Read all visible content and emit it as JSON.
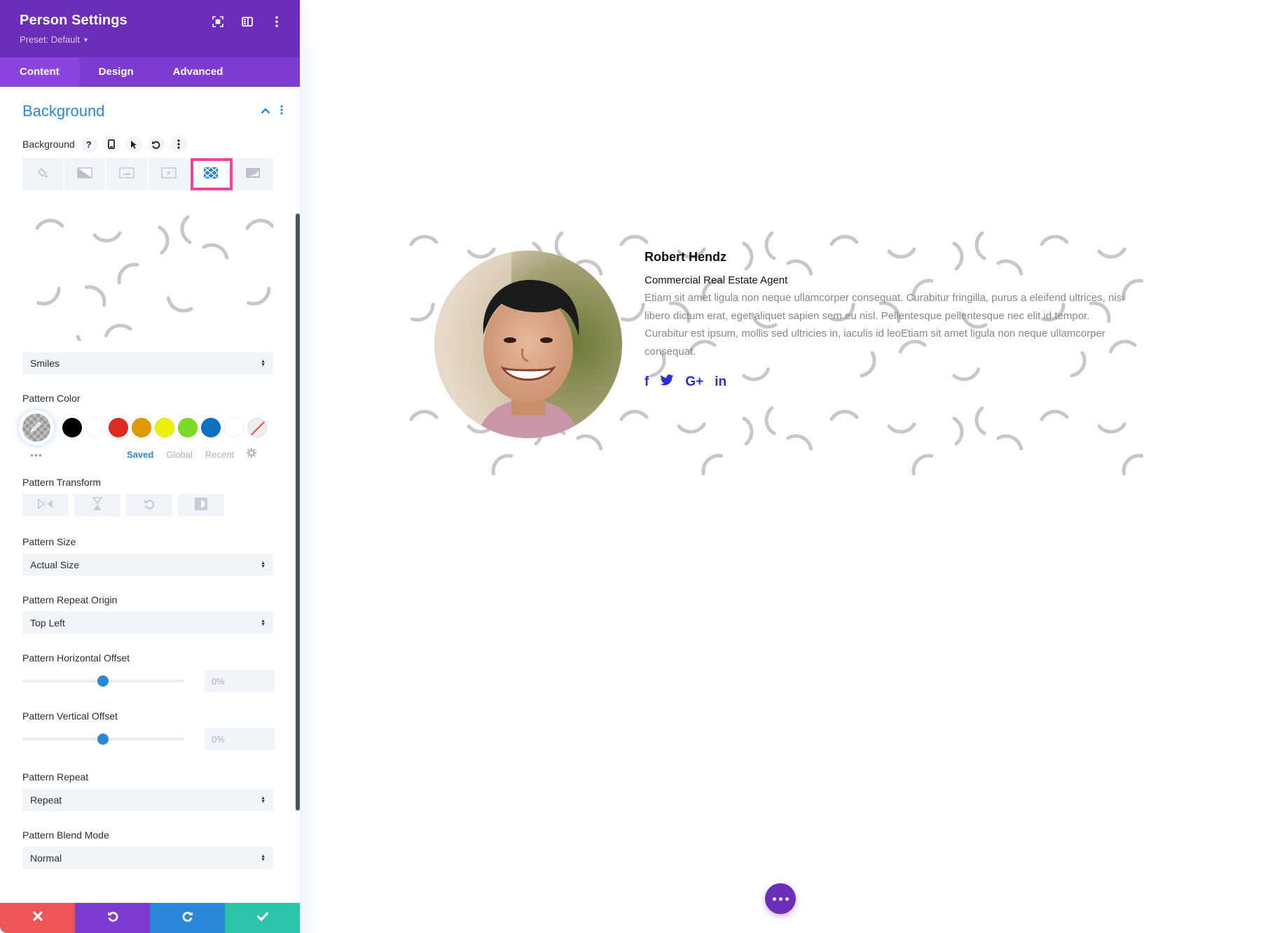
{
  "panel": {
    "title": "Person Settings",
    "preset_label": "Preset: Default",
    "header_icons": [
      "fullscreen-icon",
      "sidebar-toggle-icon",
      "more-vertical-icon"
    ],
    "tabs": [
      {
        "label": "Content",
        "active": true
      },
      {
        "label": "Design",
        "active": false
      },
      {
        "label": "Advanced",
        "active": false
      }
    ]
  },
  "background_section": {
    "title": "Background",
    "field_label": "Background",
    "field_tools": [
      "help-icon",
      "responsive-icon",
      "hover-icon",
      "reset-icon",
      "more-icon"
    ],
    "types": [
      {
        "name": "color-fill-icon",
        "active": false
      },
      {
        "name": "gradient-icon",
        "active": false
      },
      {
        "name": "image-icon",
        "active": false
      },
      {
        "name": "video-icon",
        "active": false
      },
      {
        "name": "pattern-icon",
        "active": true
      },
      {
        "name": "mask-icon",
        "active": false
      }
    ],
    "pattern_select": "Smiles",
    "pattern_color": {
      "label": "Pattern Color",
      "swatches": [
        "#000000",
        "#ffffff",
        "#e02b20",
        "#e09900",
        "#edf000",
        "#7cda24",
        "#0c71c3",
        "#ffffff"
      ],
      "tabs": [
        {
          "label": "Saved",
          "active": true
        },
        {
          "label": "Global",
          "active": false
        },
        {
          "label": "Recent",
          "active": false
        }
      ]
    },
    "pattern_transform": {
      "label": "Pattern Transform",
      "buttons": [
        "flip-horizontal-icon",
        "flip-vertical-icon",
        "rotate-icon",
        "invert-icon"
      ]
    },
    "pattern_size": {
      "label": "Pattern Size",
      "value": "Actual Size"
    },
    "pattern_repeat_origin": {
      "label": "Pattern Repeat Origin",
      "value": "Top Left"
    },
    "pattern_h_offset": {
      "label": "Pattern Horizontal Offset",
      "value": "0%",
      "slider_percent": 50
    },
    "pattern_v_offset": {
      "label": "Pattern Vertical Offset",
      "value": "0%",
      "slider_percent": 50
    },
    "pattern_repeat": {
      "label": "Pattern Repeat",
      "value": "Repeat"
    },
    "pattern_blend_mode": {
      "label": "Pattern Blend Mode",
      "value": "Normal"
    }
  },
  "footer": {
    "buttons": [
      {
        "name": "discard-button",
        "icon": "close-icon",
        "color": "#ef5555"
      },
      {
        "name": "undo-button",
        "icon": "undo-icon",
        "color": "#7e3bd0"
      },
      {
        "name": "redo-button",
        "icon": "redo-icon",
        "color": "#2b87da"
      },
      {
        "name": "save-button",
        "icon": "check-icon",
        "color": "#29c4a9"
      }
    ]
  },
  "person": {
    "name": "Robert Hendz",
    "position": "Commercial Real Estate Agent",
    "bio": "Etiam sit amet ligula non neque ullamcorper consequat. Curabitur fringilla, purus a eleifend ultrices, nisi libero dictum erat, eget aliquet sapien sem eu nisl. Pellentesque pellentesque nec elit id tempor. Curabitur est ipsum, mollis sed ultricies in, iaculis id leoEtiam sit amet ligula non neque ullamcorper consequat.",
    "socials": [
      {
        "name": "facebook",
        "glyph": "f"
      },
      {
        "name": "twitter",
        "glyph": "🐦"
      },
      {
        "name": "google-plus",
        "glyph": "G+"
      },
      {
        "name": "linkedin",
        "glyph": "in"
      }
    ]
  },
  "colors": {
    "brand_purple": "#6c2eb9",
    "accent_blue": "#2b87da",
    "highlight_pink": "#f0439a",
    "pattern_gray": "#c7c7c7",
    "social_blue": "#2b2bd8"
  }
}
